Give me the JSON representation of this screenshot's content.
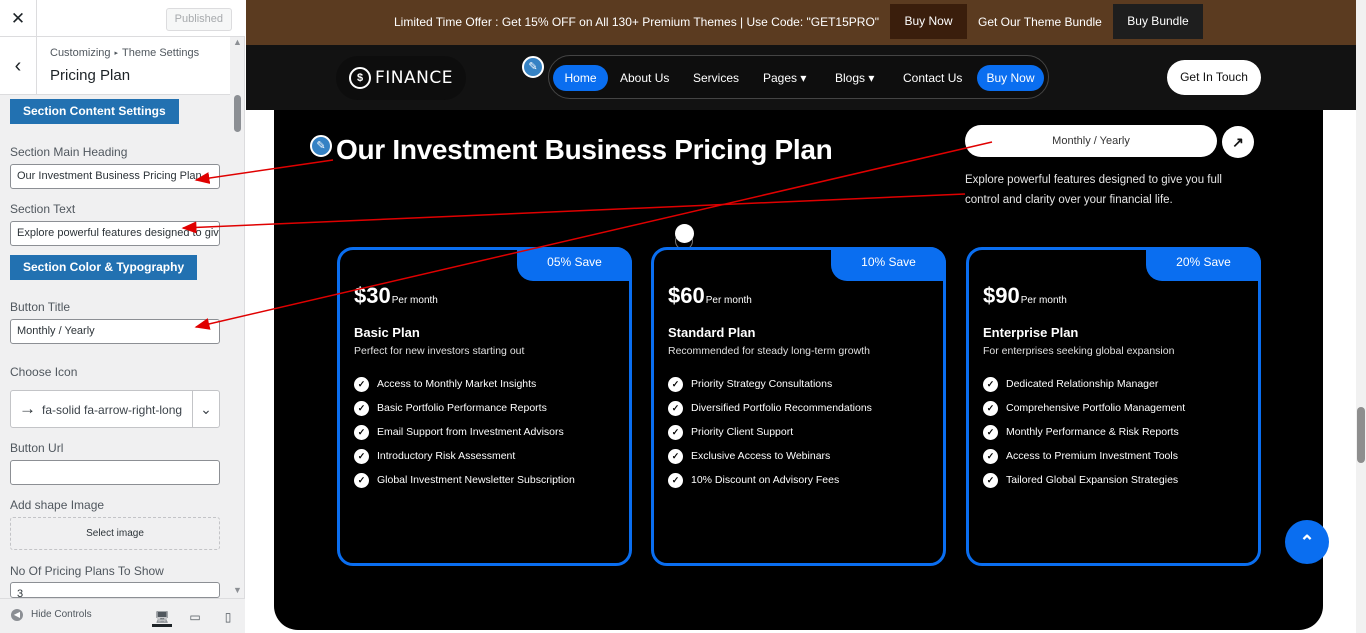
{
  "customizer": {
    "close_icon": "close-icon",
    "published_label": "Published",
    "breadcrumb_1": "Customizing",
    "breadcrumb_2": "Theme Settings",
    "panel_title": "Pricing Plan",
    "section_content_label": "Section Content Settings",
    "main_heading_label": "Section Main Heading",
    "main_heading_value": "Our Investment Business Pricing Plan",
    "section_text_label": "Section Text",
    "section_text_value": "Explore powerful features designed to give you full control and clarity over your financial life.",
    "section_color_label": "Section Color & Typography",
    "button_title_label": "Button Title",
    "button_title_value": "Monthly / Yearly",
    "choose_icon_label": "Choose Icon",
    "icon_value": "fa-solid fa-arrow-right-long",
    "button_url_label": "Button Url",
    "button_url_value": "",
    "shape_image_label": "Add shape Image",
    "select_image_label": "Select image",
    "plans_count_label": "No Of Pricing Plans To Show",
    "plans_count_value": "3",
    "hide_controls_label": "Hide Controls"
  },
  "topbar": {
    "offer_text": "Limited Time Offer : Get 15% OFF on All 130+ Premium Themes | Use Code: \"GET15PRO\"",
    "buy_now": "Buy Now",
    "bundle_text": "Get Our Theme Bundle",
    "buy_bundle": "Buy Bundle"
  },
  "nav": {
    "logo_text": "FINANCE",
    "logo_mark": "$",
    "items": [
      "Home",
      "About Us",
      "Services",
      "Pages",
      "Blogs",
      "Contact Us",
      "Buy Now"
    ],
    "cta": "Get In Touch"
  },
  "section": {
    "title": "Our Investment Business Pricing Plan",
    "toggle_label": "Monthly / Yearly",
    "arrow_icon": "↗",
    "description": "Explore powerful features designed to give you full control and clarity over your financial life."
  },
  "plans": [
    {
      "badge": "05% Save",
      "price": "$30",
      "period": "Per month",
      "name": "Basic Plan",
      "tagline": "Perfect for new investors starting out",
      "features": [
        "Access to Monthly Market Insights",
        "Basic Portfolio Performance Reports",
        "Email Support from Investment Advisors",
        "Introductory Risk Assessment",
        "Global Investment Newsletter Subscription"
      ]
    },
    {
      "badge": "10% Save",
      "price": "$60",
      "period": "Per month",
      "name": "Standard Plan",
      "tagline": "Recommended for steady long-term growth",
      "features": [
        "Priority Strategy Consultations",
        "Diversified Portfolio Recommendations",
        "Priority Client Support",
        "Exclusive Access to Webinars",
        "10% Discount on Advisory Fees"
      ]
    },
    {
      "badge": "20% Save",
      "price": "$90",
      "period": "Per month",
      "name": "Enterprise Plan",
      "tagline": "For enterprises seeking global expansion",
      "features": [
        "Dedicated Relationship Manager",
        "Comprehensive Portfolio Management",
        "Monthly Performance & Risk Reports",
        "Access to Premium Investment Tools",
        "Tailored Global Expansion Strategies"
      ]
    }
  ],
  "colors": {
    "accent": "#0a6ef0",
    "topbar": "#5b3b20",
    "wp_blue": "#2271b1",
    "annotation": "#e00000"
  }
}
